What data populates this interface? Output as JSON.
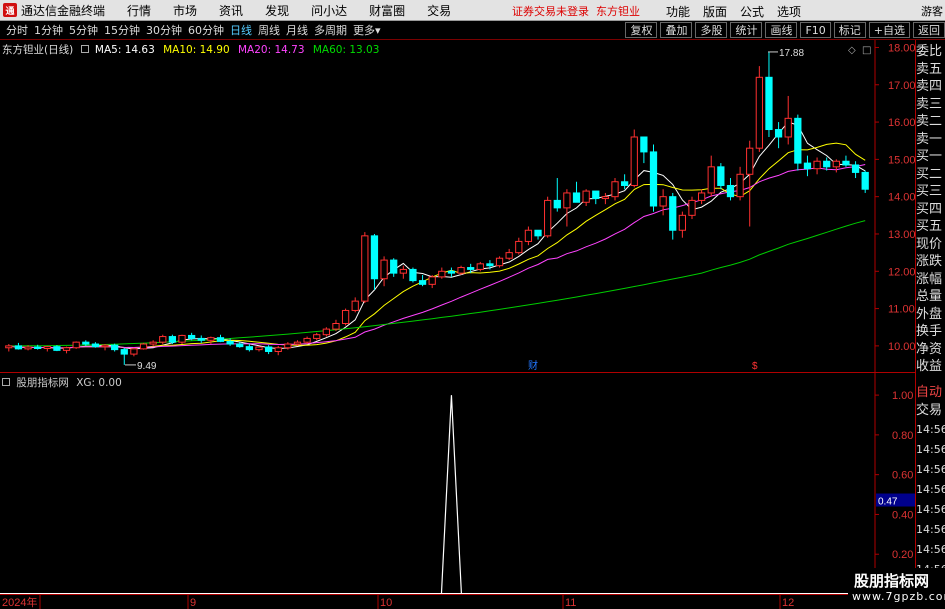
{
  "app": {
    "name": "通达信金融终端",
    "logo_text": "通"
  },
  "menu": [
    "行情",
    "市场",
    "资讯",
    "发现",
    "问小达",
    "财富圈",
    "交易"
  ],
  "warning": "证券交易未登录",
  "stock_name": "东方钽业",
  "menu_right": [
    "功能",
    "版面",
    "公式",
    "选项"
  ],
  "guest": "游客",
  "timeframes": [
    "分时",
    "1分钟",
    "5分钟",
    "15分钟",
    "30分钟",
    "60分钟",
    "日线",
    "周线",
    "月线",
    "多周期",
    "更多"
  ],
  "active_timeframe": "日线",
  "toolbar_right": [
    "复权",
    "叠加",
    "多股",
    "统计",
    "画线",
    "F10",
    "标记",
    "+自选",
    "返回"
  ],
  "price_info": {
    "title": "东方钽业(日线)",
    "ma5": "MA5: 14.63",
    "ma10": "MA10: 14.90",
    "ma20": "MA20: 14.73",
    "ma60": "MA60: 13.03",
    "colors": {
      "ma5": "#ffffff",
      "ma10": "#ffff00",
      "ma20": "#ff44ff",
      "ma60": "#00dd00"
    }
  },
  "indicator_info": {
    "name": "股朋指标网",
    "xg": "XG: 0.00"
  },
  "price_axis": {
    "labels": [
      "18.00",
      "17.00",
      "16.00",
      "15.00",
      "14.00",
      "13.00",
      "12.00",
      "11.00",
      "10.00"
    ],
    "min": 9.3,
    "max": 18.2
  },
  "indicator_axis": {
    "labels": [
      "1.00",
      "0.80",
      "0.60",
      "0.40",
      "0.20"
    ],
    "current": "0.47"
  },
  "annotations": {
    "high": "17.88",
    "low": "9.49",
    "finance_mark": "财",
    "dollar_mark": "$"
  },
  "date_axis": [
    "2024年",
    "9",
    "10",
    "11",
    "12"
  ],
  "right_panel": [
    "委比",
    "卖五",
    "卖四",
    "卖三",
    "卖二",
    "卖一",
    "买一",
    "买二",
    "买三",
    "买四",
    "买五",
    "现价",
    "涨跌",
    "涨幅",
    "总量",
    "外盘",
    "换手",
    "净资",
    "收益"
  ],
  "right_panel2": {
    "auto": "自动",
    "trade": "交易",
    "times": [
      "14:56",
      "14:56",
      "14:56",
      "14:56",
      "14:56",
      "14:56",
      "14:56",
      "14:56",
      "14:56"
    ]
  },
  "watermark": {
    "title": "股朋指标网",
    "url": "www.7gpzb.com"
  },
  "chart_data": {
    "type": "candlestick",
    "title": "东方钽业(日线)",
    "candles": [
      [
        9.95,
        10.05,
        9.85,
        10.0
      ],
      [
        10.0,
        10.08,
        9.9,
        9.92
      ],
      [
        9.92,
        10.02,
        9.88,
        9.97
      ],
      [
        9.97,
        10.03,
        9.9,
        9.93
      ],
      [
        9.93,
        10.0,
        9.85,
        9.98
      ],
      [
        9.98,
        10.02,
        9.86,
        9.88
      ],
      [
        9.88,
        9.98,
        9.8,
        9.95
      ],
      [
        9.95,
        10.12,
        9.92,
        10.1
      ],
      [
        10.1,
        10.15,
        10.0,
        10.05
      ],
      [
        10.05,
        10.1,
        9.95,
        9.98
      ],
      [
        9.98,
        10.05,
        9.88,
        10.02
      ],
      [
        10.02,
        10.06,
        9.85,
        9.9
      ],
      [
        9.9,
        9.95,
        9.49,
        9.78
      ],
      [
        9.78,
        9.95,
        9.72,
        9.92
      ],
      [
        9.92,
        10.08,
        9.9,
        10.05
      ],
      [
        10.05,
        10.15,
        10.0,
        10.1
      ],
      [
        10.1,
        10.3,
        10.05,
        10.25
      ],
      [
        10.25,
        10.3,
        10.05,
        10.1
      ],
      [
        10.1,
        10.3,
        10.05,
        10.28
      ],
      [
        10.28,
        10.35,
        10.15,
        10.2
      ],
      [
        10.2,
        10.28,
        10.08,
        10.15
      ],
      [
        10.15,
        10.25,
        10.05,
        10.22
      ],
      [
        10.22,
        10.3,
        10.1,
        10.12
      ],
      [
        10.12,
        10.2,
        10.0,
        10.05
      ],
      [
        10.05,
        10.1,
        9.95,
        9.98
      ],
      [
        9.98,
        10.05,
        9.85,
        9.9
      ],
      [
        9.9,
        10.0,
        9.85,
        9.97
      ],
      [
        9.97,
        10.02,
        9.78,
        9.85
      ],
      [
        9.85,
        10.0,
        9.75,
        9.95
      ],
      [
        9.95,
        10.1,
        9.9,
        10.05
      ],
      [
        10.05,
        10.15,
        10.0,
        10.1
      ],
      [
        10.1,
        10.25,
        10.05,
        10.2
      ],
      [
        10.2,
        10.35,
        10.15,
        10.3
      ],
      [
        10.3,
        10.5,
        10.25,
        10.45
      ],
      [
        10.45,
        10.7,
        10.4,
        10.6
      ],
      [
        10.6,
        11.0,
        10.55,
        10.95
      ],
      [
        10.95,
        11.3,
        10.9,
        11.2
      ],
      [
        11.2,
        13.05,
        11.15,
        12.95
      ],
      [
        12.95,
        13.0,
        11.5,
        11.8
      ],
      [
        11.8,
        12.4,
        11.6,
        12.3
      ],
      [
        12.3,
        12.35,
        11.85,
        11.95
      ],
      [
        11.95,
        12.15,
        11.8,
        12.05
      ],
      [
        12.05,
        12.1,
        11.7,
        11.75
      ],
      [
        11.75,
        11.9,
        11.6,
        11.65
      ],
      [
        11.65,
        11.9,
        11.55,
        11.85
      ],
      [
        11.85,
        12.1,
        11.8,
        12.0
      ],
      [
        12.0,
        12.1,
        11.85,
        11.95
      ],
      [
        11.95,
        12.15,
        11.9,
        12.1
      ],
      [
        12.1,
        12.2,
        11.95,
        12.05
      ],
      [
        12.05,
        12.25,
        12.0,
        12.2
      ],
      [
        12.2,
        12.3,
        12.05,
        12.15
      ],
      [
        12.15,
        12.4,
        12.1,
        12.35
      ],
      [
        12.35,
        12.6,
        12.3,
        12.5
      ],
      [
        12.5,
        12.9,
        12.45,
        12.8
      ],
      [
        12.8,
        13.2,
        12.7,
        13.1
      ],
      [
        13.1,
        13.0,
        12.85,
        12.95
      ],
      [
        12.95,
        14.0,
        12.9,
        13.9
      ],
      [
        13.9,
        14.5,
        13.6,
        13.7
      ],
      [
        13.7,
        14.2,
        13.2,
        14.1
      ],
      [
        14.1,
        14.4,
        13.9,
        13.85
      ],
      [
        13.85,
        14.2,
        13.75,
        14.15
      ],
      [
        14.15,
        14.1,
        13.8,
        13.95
      ],
      [
        13.95,
        14.1,
        13.8,
        14.0
      ],
      [
        14.0,
        14.5,
        13.9,
        14.4
      ],
      [
        14.4,
        14.6,
        14.2,
        14.3
      ],
      [
        14.3,
        15.8,
        14.25,
        15.6
      ],
      [
        15.6,
        15.5,
        14.9,
        15.2
      ],
      [
        15.2,
        15.4,
        13.6,
        13.75
      ],
      [
        13.75,
        14.2,
        13.5,
        14.0
      ],
      [
        14.0,
        14.1,
        12.85,
        13.1
      ],
      [
        13.1,
        13.6,
        12.9,
        13.5
      ],
      [
        13.5,
        14.0,
        13.4,
        13.9
      ],
      [
        13.9,
        14.2,
        13.8,
        14.1
      ],
      [
        14.1,
        15.1,
        14.0,
        14.8
      ],
      [
        14.8,
        14.9,
        14.2,
        14.3
      ],
      [
        14.3,
        14.5,
        13.9,
        14.0
      ],
      [
        14.0,
        14.8,
        13.9,
        14.6
      ],
      [
        14.6,
        15.5,
        13.2,
        15.3
      ],
      [
        15.3,
        17.5,
        15.2,
        17.2
      ],
      [
        17.2,
        17.88,
        15.6,
        15.8
      ],
      [
        15.8,
        16.0,
        15.3,
        15.6
      ],
      [
        15.6,
        16.7,
        15.4,
        16.1
      ],
      [
        16.1,
        16.2,
        14.7,
        14.9
      ],
      [
        14.9,
        15.1,
        14.55,
        14.75
      ],
      [
        14.75,
        15.05,
        14.6,
        14.95
      ],
      [
        14.95,
        15.05,
        14.7,
        14.8
      ],
      [
        14.8,
        15.0,
        14.65,
        14.95
      ],
      [
        14.95,
        15.1,
        14.8,
        14.85
      ],
      [
        14.85,
        14.95,
        14.5,
        14.65
      ],
      [
        14.65,
        14.7,
        14.1,
        14.2
      ]
    ],
    "xg_peak_index": 46
  }
}
